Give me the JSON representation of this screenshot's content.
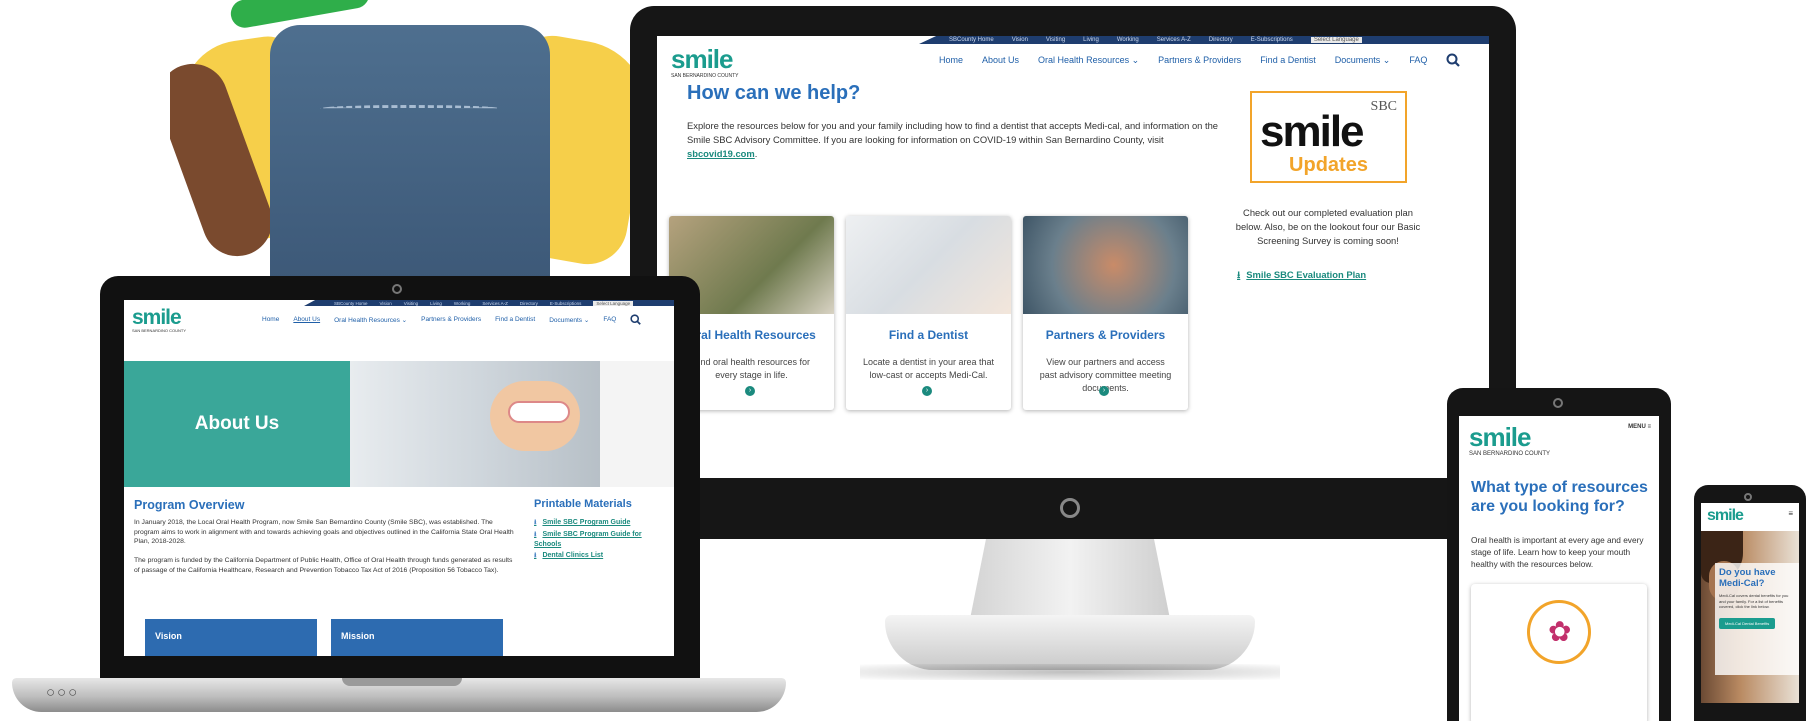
{
  "colors": {
    "teal": "#1b9c8e",
    "blue": "#2a6fba",
    "navy": "#1e3d6f",
    "orange": "#f2a42a",
    "dark": "#161616"
  },
  "site": {
    "logo": "smile",
    "logo_sub": "SAN BERNARDINO COUNTY",
    "utility_links": [
      "SBCounty Home",
      "Vision",
      "Visiting",
      "Living",
      "Working",
      "Services A-Z",
      "Directory",
      "E-Subscriptions"
    ],
    "language_label": "Select Language",
    "nav": [
      "Home",
      "About Us",
      "Oral Health Resources",
      "Partners & Providers",
      "Find a Dentist",
      "Documents",
      "FAQ"
    ],
    "search_icon": "search-icon"
  },
  "desktop": {
    "title": "How can we help?",
    "intro": "Explore the resources below for you and your family including how to find a dentist that accepts Medi-cal, and information on the Smile SBC Advisory Committee. If you are looking for information on COVID-19 within San Bernardino County, visit",
    "intro_link": "sbcovid19.com",
    "cards": [
      {
        "title": "Oral Health Resources",
        "text": "Find oral health resources for every stage in life."
      },
      {
        "title": "Find a Dentist",
        "text": "Locate a dentist in your area that low-cast or accepts Medi-Cal."
      },
      {
        "title": "Partners & Providers",
        "text": "View our partners and access past advisory committee meeting documents."
      }
    ],
    "updates": {
      "sbc": "SBC",
      "smile": "smile",
      "word": "Updates"
    },
    "updates_text": "Check out our completed evaluation plan below. Also, be on the lookout four our Basic Screening Survey is coming soon!",
    "eval_link": "Smile SBC Evaluation Plan"
  },
  "laptop": {
    "banner_title": "About Us",
    "program_title": "Program Overview",
    "para1": "In January 2018, the Local Oral Health Program, now Smile San Bernardino County (Smile SBC), was established. The program aims to work in alignment with and towards achieving goals and objectives outlined in the California State Oral Health Plan, 2018-2028.",
    "para2": "The program is funded by the California Department of Public Health, Office of Oral Health through funds generated as results of passage of the California Healthcare, Research and Prevention Tobacco Tax Act of 2016 (Proposition 56 Tobacco Tax).",
    "materials_title": "Printable Materials",
    "materials": [
      "Smile SBC Program Guide",
      "Smile SBC Program Guide for Schools",
      "Dental Clinics List"
    ],
    "boxes": [
      "Vision",
      "Mission"
    ]
  },
  "tablet": {
    "menu": "MENU",
    "heading": "What type of resources are you looking for?",
    "text": "Oral health is important at every age and every stage of life. Learn how to keep your mouth healthy with the resources below."
  },
  "phone": {
    "heading": "Do you have Medi-Cal?",
    "text": "Medi-Cal covers dental benefits for you and your family. For a list of benefits covered, click the link below.",
    "button": "Medi-Cal Dental Benefits"
  }
}
